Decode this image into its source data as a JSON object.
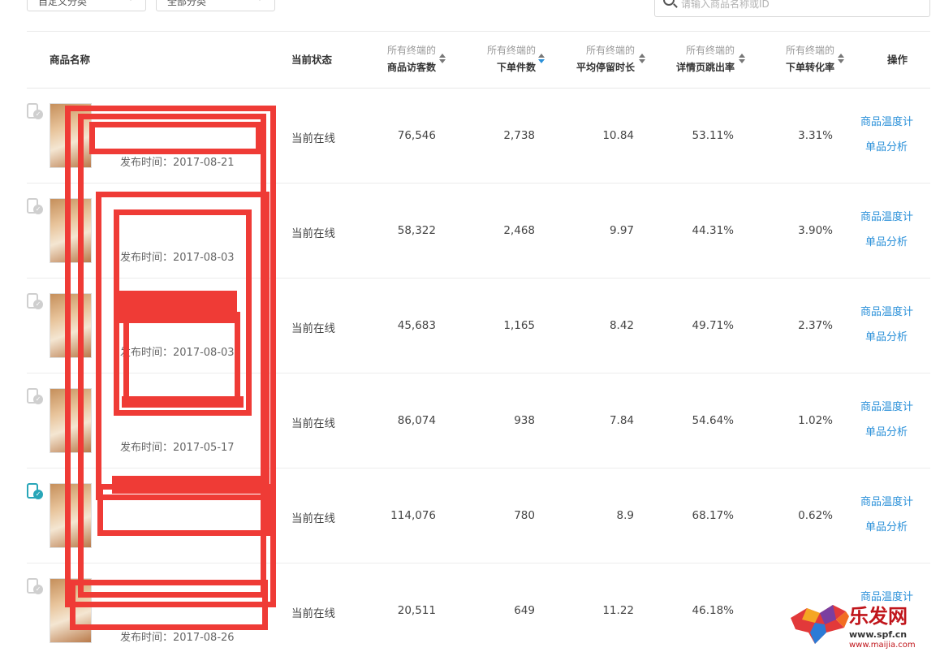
{
  "filters": [
    {
      "label": "自定义分类"
    },
    {
      "label": "全部分类"
    }
  ],
  "search": {
    "placeholder": "请输入商品名称或ID",
    "clear": "×"
  },
  "table": {
    "headers": {
      "name": "商品名称",
      "status": "当前状态",
      "visitors": {
        "line1": "所有终端的",
        "line2": "商品访客数"
      },
      "orders": {
        "line1": "所有终端的",
        "line2": "下单件数"
      },
      "stay": {
        "line1": "所有终端的",
        "line2": "平均停留时长"
      },
      "bounce": {
        "line1": "所有终端的",
        "line2": "详情页跳出率"
      },
      "conv": {
        "line1": "所有终端的",
        "line2": "下单转化率"
      },
      "actions": "操作"
    },
    "active_sort": "orders",
    "rows": [
      {
        "date": "发布时间：2017-08-21",
        "status": "当前在线",
        "visitors": "76,546",
        "orders": "2,738",
        "stay": "10.84",
        "bounce": "53.11%",
        "conv": "3.31%",
        "action1": "商品温度计",
        "action2": "单品分析",
        "mobile": false
      },
      {
        "date": "发布时间：2017-08-03",
        "status": "当前在线",
        "visitors": "58,322",
        "orders": "2,468",
        "stay": "9.97",
        "bounce": "44.31%",
        "conv": "3.90%",
        "action1": "商品温度计",
        "action2": "单品分析",
        "mobile": false
      },
      {
        "date": "发布时间：2017-08-03",
        "status": "当前在线",
        "visitors": "45,683",
        "orders": "1,165",
        "stay": "8.42",
        "bounce": "49.71%",
        "conv": "2.37%",
        "action1": "商品温度计",
        "action2": "单品分析",
        "mobile": false
      },
      {
        "date": "发布时间：2017-05-17",
        "status": "当前在线",
        "visitors": "86,074",
        "orders": "938",
        "stay": "7.84",
        "bounce": "54.64%",
        "conv": "1.02%",
        "action1": "商品温度计",
        "action2": "单品分析",
        "mobile": false
      },
      {
        "date": "",
        "status": "当前在线",
        "visitors": "114,076",
        "orders": "780",
        "stay": "8.9",
        "bounce": "68.17%",
        "conv": "0.62%",
        "action1": "商品温度计",
        "action2": "单品分析",
        "mobile": true
      },
      {
        "date": "发布时间：2017-08-26",
        "status": "当前在线",
        "visitors": "20,511",
        "orders": "649",
        "stay": "11.22",
        "bounce": "46.18%",
        "conv": "",
        "action1": "商品温度计",
        "action2": "",
        "mobile": false
      }
    ]
  },
  "watermark": {
    "brand": "乐发网",
    "url": "www.spf.cn",
    "url2": "www.maijia.com"
  },
  "colors": {
    "link": "#2a90d9",
    "mobile_active": "#28a6b8",
    "redaction": "#ef3b36"
  }
}
